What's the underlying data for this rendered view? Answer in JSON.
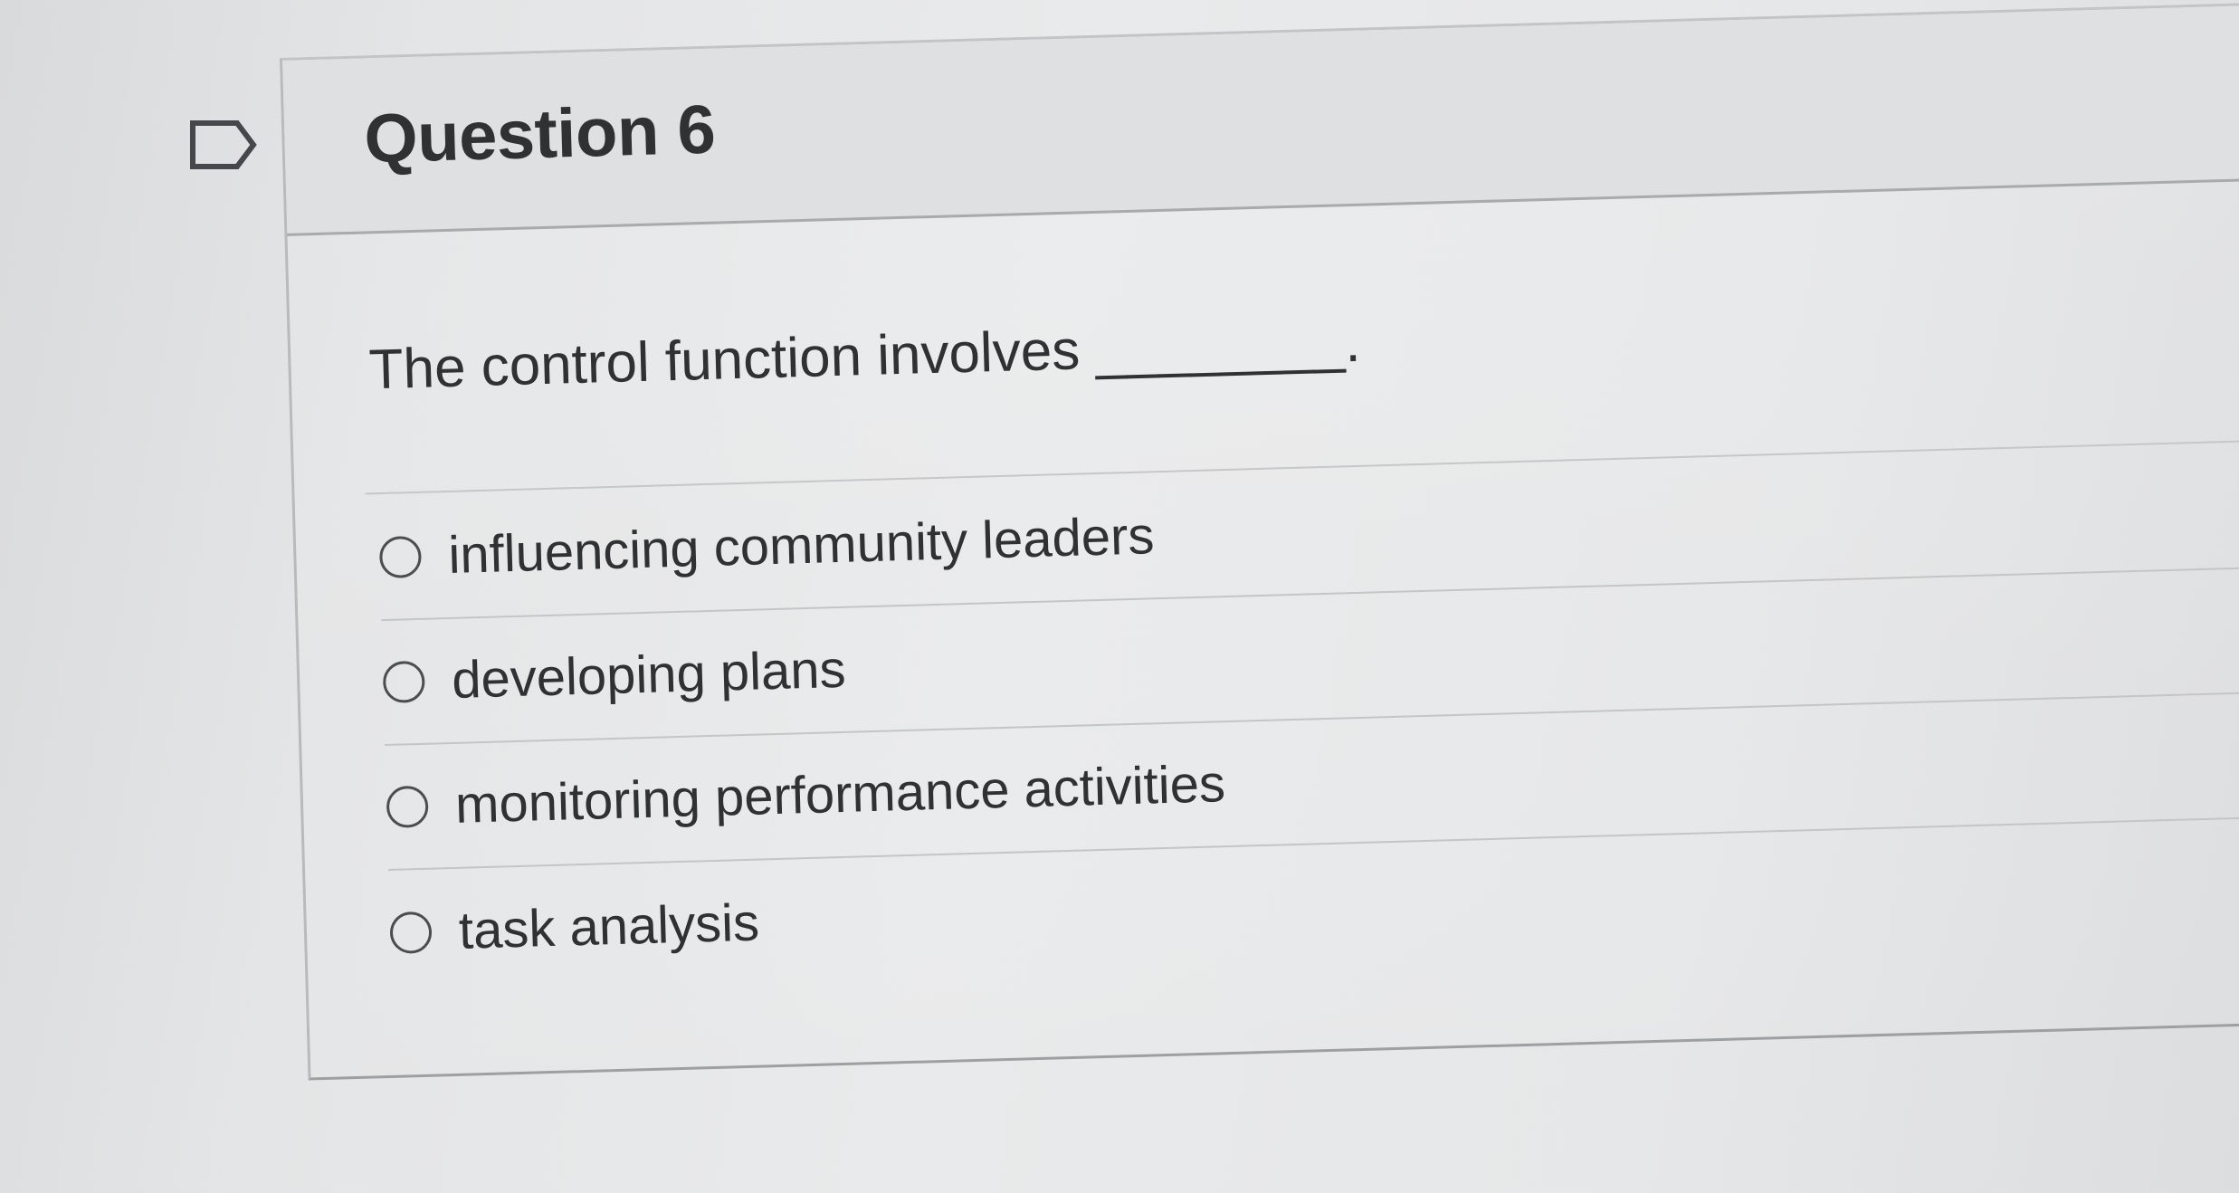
{
  "question": {
    "title": "Question 6",
    "text": "The control function involves ________."
  },
  "answers": [
    {
      "label": "influencing community leaders",
      "selected": false
    },
    {
      "label": "developing plans",
      "selected": false
    },
    {
      "label": "monitoring performance activities",
      "selected": false
    },
    {
      "label": "task analysis",
      "selected": false
    }
  ],
  "icons": {
    "flag": "bookmark-flag-icon",
    "radio": "radio-unchecked"
  },
  "colors": {
    "text": "#2f3133",
    "border": "#a9aaab",
    "header_bg": "#dfe0e1"
  }
}
